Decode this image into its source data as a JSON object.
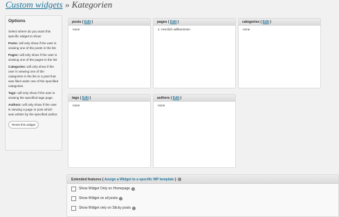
{
  "header": {
    "title_link": "Custom widgets",
    "title_rest": " » Kategorien"
  },
  "sidebar": {
    "title": "Options",
    "intro": "Select where do you want this specific widget to show:",
    "items": [
      {
        "label": "Posts:",
        "text": " will only show if the user is viewing one of the posts in the list"
      },
      {
        "label": "Pages:",
        "text": " will only show if the user is viewing one of the pages in the list"
      },
      {
        "label": "Categories:",
        "text": " will only show if the user is viewing one of the categories in the list or a post that was filed under one of the specified categories."
      },
      {
        "label": "Tags:",
        "text": " will only show if the user is viewing the specified tags page."
      },
      {
        "label": "Authors:",
        "text": " will only show if the user is viewing a page or post which was written by the specified author."
      }
    ],
    "reset_label": "Reset this widget"
  },
  "panels": {
    "posts": {
      "name": "posts",
      "open": " ( ",
      "edit": "Edit",
      "close": " )",
      "content": "none"
    },
    "pages": {
      "name": "pages",
      "open": " ( ",
      "edit": "Edit",
      "close": " )",
      "content": "1. Herzlich willkommen"
    },
    "categories": {
      "name": "categories",
      "open": " ( ",
      "edit": "Edit",
      "close": " )",
      "content": "none"
    },
    "tags": {
      "name": "tags",
      "open": " ( ",
      "edit": "Edit",
      "close": " )",
      "content": "none"
    },
    "authors": {
      "name": "authors",
      "open": " ( ",
      "edit": "Edit",
      "close": " )",
      "content": "none"
    }
  },
  "extended": {
    "title_pre": "Extended features { ",
    "title_link": "Assign a Widget to a specific WP template",
    "title_post": " }",
    "help_glyph": "?",
    "options": [
      "Show Widget Only on Homepage",
      "Show Widget on all posts",
      "Show Widget only on Sticky posts"
    ]
  },
  "colors": {
    "link": "#21759b",
    "background": "#f1f1f1"
  }
}
